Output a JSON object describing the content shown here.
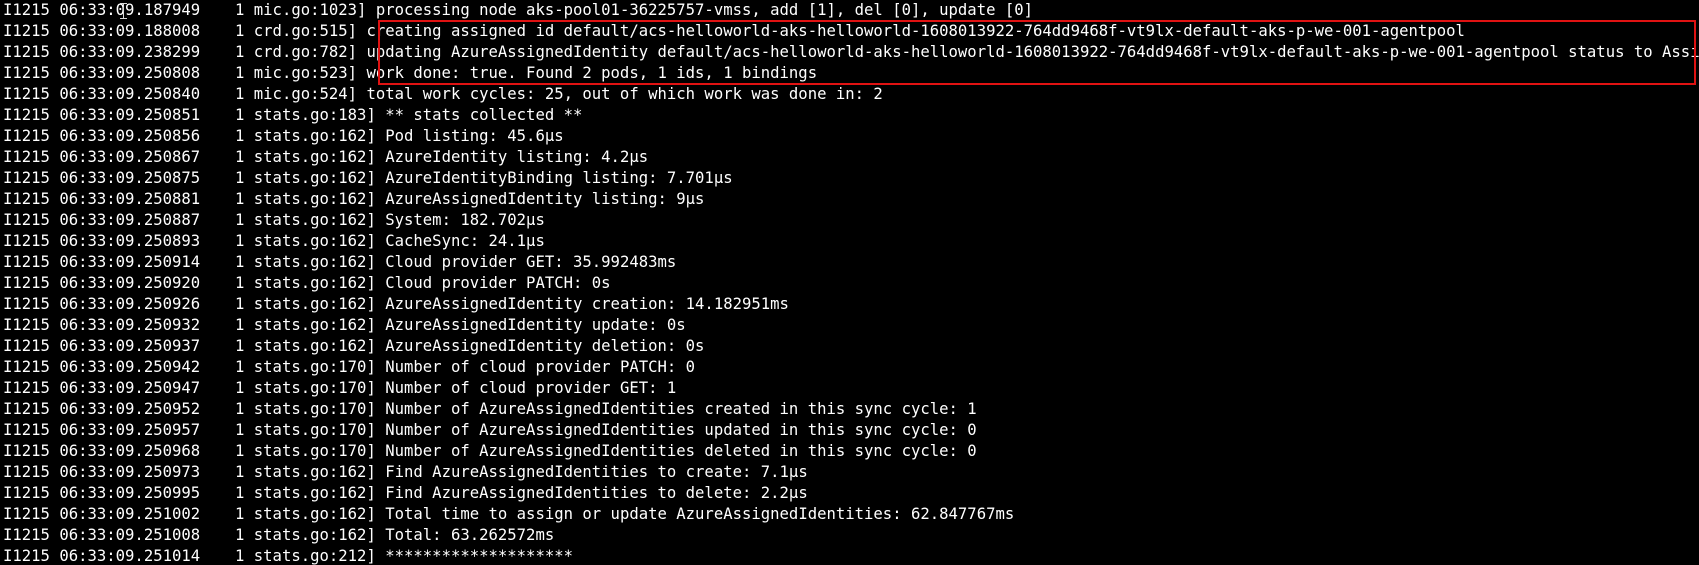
{
  "terminal": {
    "highlight_color": "#e01212",
    "text_color": "#ffffff",
    "background": "#000000",
    "lines": [
      {
        "prefix": "I1215 06:33:09.187949",
        "count": "1",
        "source": "mic.go:1023]",
        "message": "processing node aks-pool01-36225757-vmss, add [1], del [0], update [0]"
      },
      {
        "prefix": "I1215 06:33:09.188008",
        "count": "1",
        "source": "crd.go:515]",
        "message": "creating assigned id default/acs-helloworld-aks-helloworld-1608013922-764dd9468f-vt9lx-default-aks-p-we-001-agentpool"
      },
      {
        "prefix": "I1215 06:33:09.238299",
        "count": "1",
        "source": "crd.go:782]",
        "message": "updating AzureAssignedIdentity default/acs-helloworld-aks-helloworld-1608013922-764dd9468f-vt9lx-default-aks-p-we-001-agentpool status to Assigned"
      },
      {
        "prefix": "I1215 06:33:09.250808",
        "count": "1",
        "source": "mic.go:523]",
        "message": "work done: true. Found 2 pods, 1 ids, 1 bindings"
      },
      {
        "prefix": "I1215 06:33:09.250840",
        "count": "1",
        "source": "mic.go:524]",
        "message": "total work cycles: 25, out of which work was done in: 2"
      },
      {
        "prefix": "I1215 06:33:09.250851",
        "count": "1",
        "source": "stats.go:183]",
        "message": "** stats collected **"
      },
      {
        "prefix": "I1215 06:33:09.250856",
        "count": "1",
        "source": "stats.go:162]",
        "message": "Pod listing: 45.6µs"
      },
      {
        "prefix": "I1215 06:33:09.250867",
        "count": "1",
        "source": "stats.go:162]",
        "message": "AzureIdentity listing: 4.2µs"
      },
      {
        "prefix": "I1215 06:33:09.250875",
        "count": "1",
        "source": "stats.go:162]",
        "message": "AzureIdentityBinding listing: 7.701µs"
      },
      {
        "prefix": "I1215 06:33:09.250881",
        "count": "1",
        "source": "stats.go:162]",
        "message": "AzureAssignedIdentity listing: 9µs"
      },
      {
        "prefix": "I1215 06:33:09.250887",
        "count": "1",
        "source": "stats.go:162]",
        "message": "System: 182.702µs"
      },
      {
        "prefix": "I1215 06:33:09.250893",
        "count": "1",
        "source": "stats.go:162]",
        "message": "CacheSync: 24.1µs"
      },
      {
        "prefix": "I1215 06:33:09.250914",
        "count": "1",
        "source": "stats.go:162]",
        "message": "Cloud provider GET: 35.992483ms"
      },
      {
        "prefix": "I1215 06:33:09.250920",
        "count": "1",
        "source": "stats.go:162]",
        "message": "Cloud provider PATCH: 0s"
      },
      {
        "prefix": "I1215 06:33:09.250926",
        "count": "1",
        "source": "stats.go:162]",
        "message": "AzureAssignedIdentity creation: 14.182951ms"
      },
      {
        "prefix": "I1215 06:33:09.250932",
        "count": "1",
        "source": "stats.go:162]",
        "message": "AzureAssignedIdentity update: 0s"
      },
      {
        "prefix": "I1215 06:33:09.250937",
        "count": "1",
        "source": "stats.go:162]",
        "message": "AzureAssignedIdentity deletion: 0s"
      },
      {
        "prefix": "I1215 06:33:09.250942",
        "count": "1",
        "source": "stats.go:170]",
        "message": "Number of cloud provider PATCH: 0"
      },
      {
        "prefix": "I1215 06:33:09.250947",
        "count": "1",
        "source": "stats.go:170]",
        "message": "Number of cloud provider GET: 1"
      },
      {
        "prefix": "I1215 06:33:09.250952",
        "count": "1",
        "source": "stats.go:170]",
        "message": "Number of AzureAssignedIdentities created in this sync cycle: 1"
      },
      {
        "prefix": "I1215 06:33:09.250957",
        "count": "1",
        "source": "stats.go:170]",
        "message": "Number of AzureAssignedIdentities updated in this sync cycle: 0"
      },
      {
        "prefix": "I1215 06:33:09.250968",
        "count": "1",
        "source": "stats.go:170]",
        "message": "Number of AzureAssignedIdentities deleted in this sync cycle: 0"
      },
      {
        "prefix": "I1215 06:33:09.250973",
        "count": "1",
        "source": "stats.go:162]",
        "message": "Find AzureAssignedIdentities to create: 7.1µs"
      },
      {
        "prefix": "I1215 06:33:09.250995",
        "count": "1",
        "source": "stats.go:162]",
        "message": "Find AzureAssignedIdentities to delete: 2.2µs"
      },
      {
        "prefix": "I1215 06:33:09.251002",
        "count": "1",
        "source": "stats.go:162]",
        "message": "Total time to assign or update AzureAssignedIdentities: 62.847767ms"
      },
      {
        "prefix": "I1215 06:33:09.251008",
        "count": "1",
        "source": "stats.go:162]",
        "message": "Total: 63.262572ms"
      },
      {
        "prefix": "I1215 06:33:09.251014",
        "count": "1",
        "source": "stats.go:212]",
        "message": "********************"
      }
    ]
  }
}
